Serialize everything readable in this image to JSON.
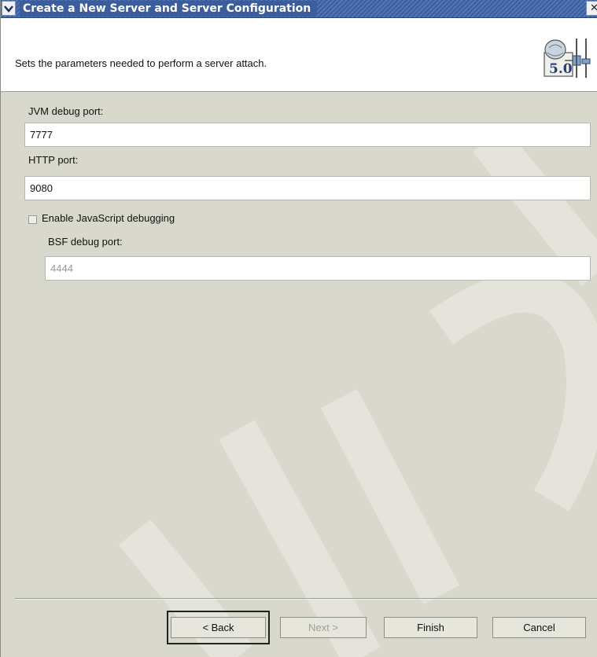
{
  "window": {
    "title": "Create a New Server and Server Configuration",
    "menu_icon": "chevron-down-icon",
    "close_icon": "close-icon"
  },
  "header": {
    "description": "Sets the parameters needed to perform a server attach.",
    "icon_name": "server-5.0-wizard-icon",
    "icon_badge": "5.0"
  },
  "form": {
    "jvm_label": "JVM debug port:",
    "jvm_value": "7777",
    "http_label": "HTTP port:",
    "http_value": "9080",
    "js_debug_label": "Enable JavaScript debugging",
    "js_debug_checked": false,
    "bsf_label": "BSF debug port:",
    "bsf_value": "4444"
  },
  "buttons": {
    "back": "< Back",
    "next": "Next >",
    "finish": "Finish",
    "cancel": "Cancel"
  },
  "colors": {
    "title_bar": "#3c5d9c",
    "panel": "#d8d8cc"
  }
}
